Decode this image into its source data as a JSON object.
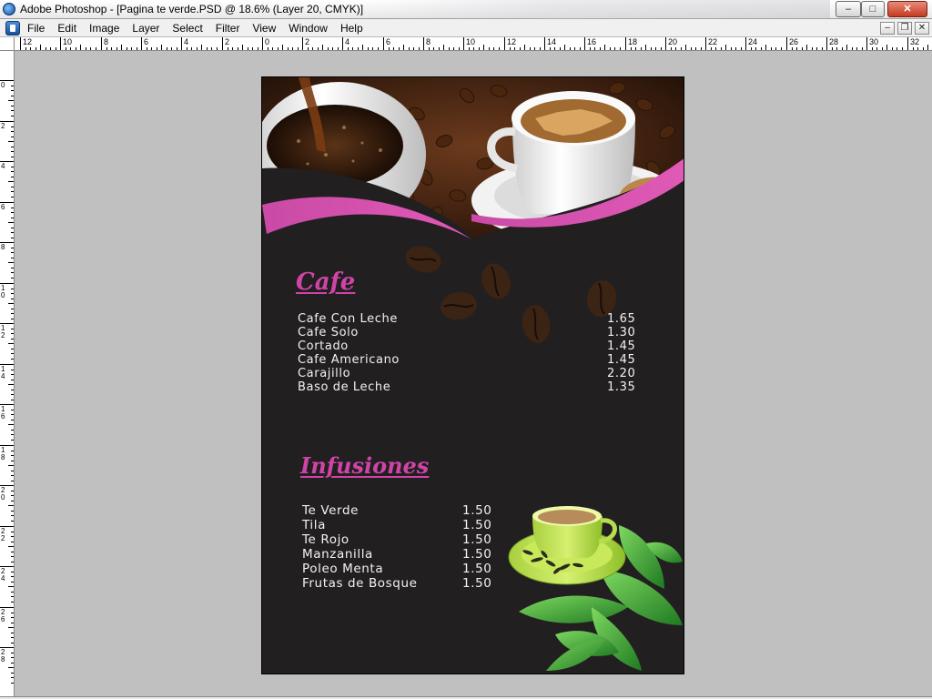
{
  "window": {
    "title": "Adobe Photoshop - [Pagina te verde.PSD @ 18.6% (Layer 20, CMYK)]",
    "minimize_label": "–",
    "restore_label": "□",
    "close_label": "✕"
  },
  "menubar": {
    "items": [
      {
        "label": "File"
      },
      {
        "label": "Edit"
      },
      {
        "label": "Image"
      },
      {
        "label": "Layer"
      },
      {
        "label": "Select"
      },
      {
        "label": "Filter"
      },
      {
        "label": "View"
      },
      {
        "label": "Window"
      },
      {
        "label": "Help"
      }
    ],
    "doc_minimize_label": "–",
    "doc_restore_label": "❐",
    "doc_close_label": "✕"
  },
  "ruler": {
    "top_labels": [
      "12",
      "10",
      "8",
      "6",
      "4",
      "2",
      "0",
      "2",
      "4",
      "6",
      "8",
      "10",
      "12",
      "14",
      "16",
      "18",
      "20",
      "22",
      "24",
      "26",
      "28",
      "30",
      "32"
    ],
    "left_labels": [
      "0",
      "2",
      "4",
      "6",
      "8",
      "10",
      "12",
      "14",
      "16",
      "18",
      "20",
      "22",
      "24",
      "26",
      "28"
    ]
  },
  "document": {
    "cafe": {
      "title": "Cafe",
      "items": [
        {
          "name": "Cafe Con Leche",
          "price": "1.65"
        },
        {
          "name": "Cafe Solo",
          "price": "1.30"
        },
        {
          "name": "Cortado",
          "price": "1.45"
        },
        {
          "name": "Cafe Americano",
          "price": "1.45"
        },
        {
          "name": "Carajillo",
          "price": "2.20"
        },
        {
          "name": "Baso de Leche",
          "price": "1.35"
        }
      ]
    },
    "infusiones": {
      "title": "Infusiones",
      "items": [
        {
          "name": "Te Verde",
          "price": "1.50"
        },
        {
          "name": "Tila",
          "price": "1.50"
        },
        {
          "name": "Te Rojo",
          "price": "1.50"
        },
        {
          "name": "Manzanilla",
          "price": "1.50"
        },
        {
          "name": "Poleo Menta",
          "price": "1.50"
        },
        {
          "name": "Frutas de Bosque",
          "price": "1.50"
        }
      ]
    },
    "colors": {
      "background": "#221f21",
      "accent_magenta": "#d044a8",
      "text": "#f2f2f2"
    }
  }
}
